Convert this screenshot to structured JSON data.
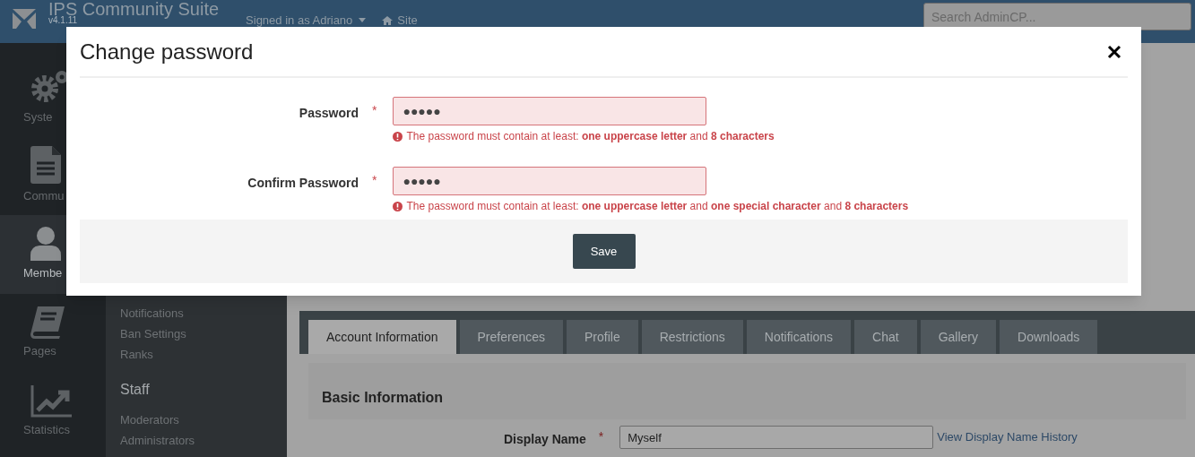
{
  "header": {
    "logo_title": "IPS Community Suite",
    "version": "v4.1.11",
    "user_menu": "Signed in as Adriano",
    "site_link": "Site",
    "search": {
      "placeholder": "Search AdminCP..."
    }
  },
  "sidebar": {
    "apps": [
      {
        "label": "Syste",
        "selected": false
      },
      {
        "label": "Commu",
        "selected": false
      },
      {
        "label": "Membe",
        "selected": true
      },
      {
        "label": "Pages",
        "selected": false
      },
      {
        "label": "Statistics",
        "selected": false
      }
    ],
    "submenu": [
      {
        "kind": "item",
        "label": "Notifications"
      },
      {
        "kind": "item",
        "label": "Ban Settings"
      },
      {
        "kind": "item",
        "label": "Ranks"
      },
      {
        "kind": "heading",
        "label": "Staff"
      },
      {
        "kind": "item",
        "label": "Moderators"
      },
      {
        "kind": "item",
        "label": "Administrators"
      }
    ]
  },
  "tabs": [
    {
      "label": "Account Information",
      "selected": true
    },
    {
      "label": "Preferences",
      "selected": false
    },
    {
      "label": "Profile",
      "selected": false
    },
    {
      "label": "Restrictions",
      "selected": false
    },
    {
      "label": "Notifications",
      "selected": false
    },
    {
      "label": "Chat",
      "selected": false
    },
    {
      "label": "Gallery",
      "selected": false
    },
    {
      "label": "Downloads",
      "selected": false
    }
  ],
  "section": {
    "title": "Basic Information",
    "field": {
      "label": "Display Name",
      "required_mark": "*",
      "value": "Myself",
      "link": "View Display Name History"
    }
  },
  "modal": {
    "title": "Change password",
    "fields": [
      {
        "label": "Password",
        "required_mark": "*",
        "value": "●●●●●",
        "error": "The password must contain at least: **one uppercase letter** and **8 characters**"
      },
      {
        "label": "Confirm Password",
        "required_mark": "*",
        "value": "●●●●●",
        "error": "The password must contain at least: **one uppercase letter** and **one special character** and **8 characters**"
      }
    ],
    "button": "Save"
  }
}
